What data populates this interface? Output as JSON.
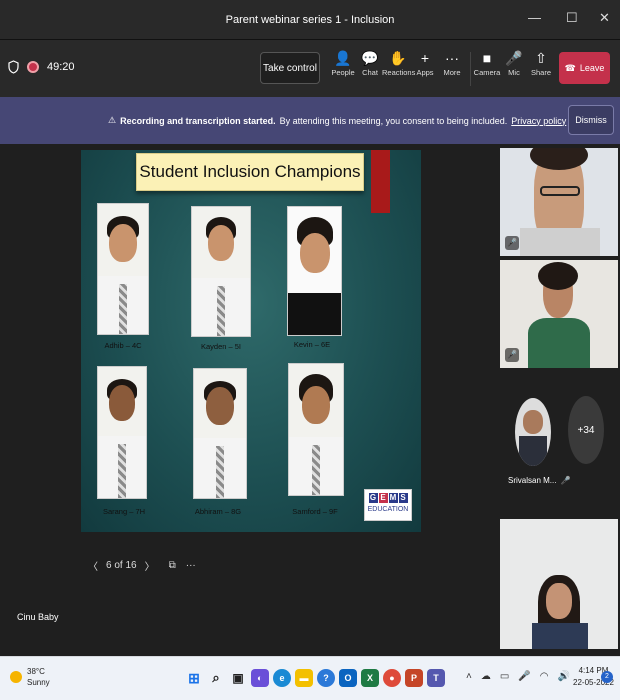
{
  "window": {
    "title": "Parent webinar series 1 - Inclusion",
    "minimize": "—",
    "maximize": "☐",
    "close": "✕"
  },
  "toolbar": {
    "timer": "49:20",
    "take_control": "Take control",
    "buttons": {
      "people": "People",
      "chat": "Chat",
      "reactions": "Reactions",
      "apps": "Apps",
      "more": "More",
      "camera": "Camera",
      "mic": "Mic",
      "share": "Share"
    },
    "leave": "Leave"
  },
  "banner": {
    "bold": "Recording and transcription started.",
    "text": "By attending this meeting, you consent to being included.",
    "link": "Privacy policy",
    "dismiss": "Dismiss"
  },
  "slide": {
    "title": "Student Inclusion Champions",
    "students": [
      "Adhib – 4C",
      "Kayden – 5I",
      "Kevin – 6E",
      "Sarang – 7H",
      "Abhiram – 8G",
      "Samford – 9F"
    ],
    "logo_text": "EDUCATION"
  },
  "slide_nav": {
    "prev": "〈",
    "page": "6 of 16",
    "next": "〉",
    "more": "···"
  },
  "presenter_name": "Cinu Baby",
  "participants": {
    "name": "Srivalsan M...",
    "overflow": "+34"
  },
  "taskbar": {
    "weather_temp": "38°C",
    "weather_desc": "Sunny",
    "time": "4:14 PM",
    "date": "22-05-2022",
    "notifications": "2"
  }
}
